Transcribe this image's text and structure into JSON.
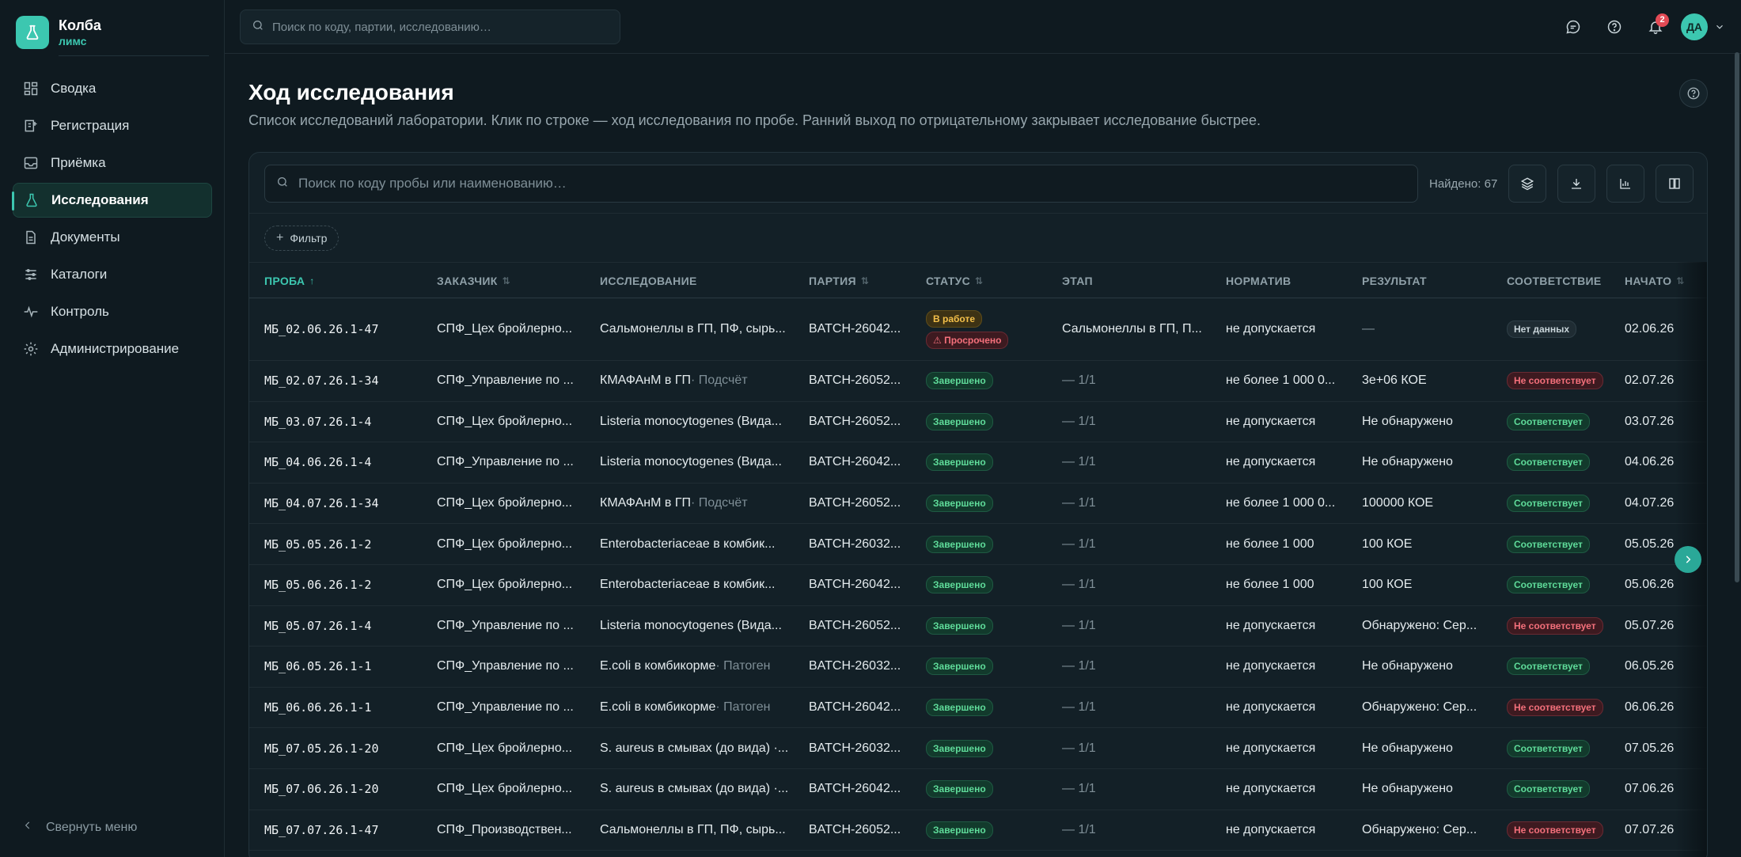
{
  "brand": {
    "name": "Колба",
    "sub": "лимс"
  },
  "sidebar": {
    "items": [
      {
        "label": "Сводка",
        "icon": "dashboard-icon"
      },
      {
        "label": "Регистрация",
        "icon": "register-icon"
      },
      {
        "label": "Приёмка",
        "icon": "inbox-icon"
      },
      {
        "label": "Исследования",
        "icon": "flask-icon",
        "active": true
      },
      {
        "label": "Документы",
        "icon": "document-icon"
      },
      {
        "label": "Каталоги",
        "icon": "catalog-icon"
      },
      {
        "label": "Контроль",
        "icon": "pulse-icon"
      },
      {
        "label": "Администрирование",
        "icon": "gear-icon"
      }
    ],
    "collapse_label": "Свернуть меню"
  },
  "topbar": {
    "search_placeholder": "Поиск по коду, партии, исследованию…",
    "notifications_count": "2",
    "avatar_initials": "ДА"
  },
  "page": {
    "title": "Ход исследования",
    "subtitle": "Список исследований лаборатории. Клик по строке — ход исследования по пробе. Ранний выход по отрицательному закрывает исследование быстрее."
  },
  "table_toolbar": {
    "search_placeholder": "Поиск по коду пробы или наименованию…",
    "found": "Найдено: 67",
    "filter_label": "Фильтр"
  },
  "columns": [
    "ПРОБА",
    "ЗАКАЗЧИК",
    "ИССЛЕДОВАНИЕ",
    "ПАРТИЯ",
    "СТАТУС",
    "ЭТАП",
    "НОРМАТИВ",
    "РЕЗУЛЬТАТ",
    "СООТВЕТСТВИЕ",
    "НАЧАТО"
  ],
  "rows": [
    {
      "sample": "МБ_02.06.26.1-47",
      "customer": "СПФ_Цех бройлерно...",
      "study": "Сальмонеллы в ГП, ПФ, сырь...",
      "study_note": "",
      "batch": "BATCH-26042...",
      "status": "В работе",
      "status2": "Просрочено",
      "stage": "Сальмонеллы в ГП, П...",
      "norm": "не допускается",
      "result": "—",
      "compliance": "Нет данных",
      "started": "02.06.26"
    },
    {
      "sample": "МБ_02.07.26.1-34",
      "customer": "СПФ_Управление по ...",
      "study": "КМАФАнМ в ГП",
      "study_note": " · Подсчёт",
      "batch": "BATCH-26052...",
      "status": "Завершено",
      "status2": "",
      "stage": "— 1/1",
      "norm": "не более 1 000 0...",
      "result": "3e+06 КОЕ",
      "compliance": "Не соответствует",
      "started": "02.07.26"
    },
    {
      "sample": "МБ_03.07.26.1-4",
      "customer": "СПФ_Цех бройлерно...",
      "study": "Listeria monocytogenes (Вида...",
      "study_note": "",
      "batch": "BATCH-26052...",
      "status": "Завершено",
      "status2": "",
      "stage": "— 1/1",
      "norm": "не допускается",
      "result": "Не обнаружено",
      "compliance": "Соответствует",
      "started": "03.07.26"
    },
    {
      "sample": "МБ_04.06.26.1-4",
      "customer": "СПФ_Управление по ...",
      "study": "Listeria monocytogenes (Вида...",
      "study_note": "",
      "batch": "BATCH-26042...",
      "status": "Завершено",
      "status2": "",
      "stage": "— 1/1",
      "norm": "не допускается",
      "result": "Не обнаружено",
      "compliance": "Соответствует",
      "started": "04.06.26"
    },
    {
      "sample": "МБ_04.07.26.1-34",
      "customer": "СПФ_Цех бройлерно...",
      "study": "КМАФАнМ в ГП",
      "study_note": " · Подсчёт",
      "batch": "BATCH-26052...",
      "status": "Завершено",
      "status2": "",
      "stage": "— 1/1",
      "norm": "не более 1 000 0...",
      "result": "100000 КОЕ",
      "compliance": "Соответствует",
      "started": "04.07.26"
    },
    {
      "sample": "МБ_05.05.26.1-2",
      "customer": "СПФ_Цех бройлерно...",
      "study": "Enterobacteriaceae в комбик...",
      "study_note": "",
      "batch": "BATCH-26032...",
      "status": "Завершено",
      "status2": "",
      "stage": "— 1/1",
      "norm": "не более 1 000",
      "result": "100 КОЕ",
      "compliance": "Соответствует",
      "started": "05.05.26"
    },
    {
      "sample": "МБ_05.06.26.1-2",
      "customer": "СПФ_Цех бройлерно...",
      "study": "Enterobacteriaceae в комбик...",
      "study_note": "",
      "batch": "BATCH-26042...",
      "status": "Завершено",
      "status2": "",
      "stage": "— 1/1",
      "norm": "не более 1 000",
      "result": "100 КОЕ",
      "compliance": "Соответствует",
      "started": "05.06.26"
    },
    {
      "sample": "МБ_05.07.26.1-4",
      "customer": "СПФ_Управление по ...",
      "study": "Listeria monocytogenes (Вида...",
      "study_note": "",
      "batch": "BATCH-26052...",
      "status": "Завершено",
      "status2": "",
      "stage": "— 1/1",
      "norm": "не допускается",
      "result": "Обнаружено: Сер...",
      "compliance": "Не соответствует",
      "started": "05.07.26"
    },
    {
      "sample": "МБ_06.05.26.1-1",
      "customer": "СПФ_Управление по ...",
      "study": "E.coli в комбикорме",
      "study_note": " · Патоген",
      "batch": "BATCH-26032...",
      "status": "Завершено",
      "status2": "",
      "stage": "— 1/1",
      "norm": "не допускается",
      "result": "Не обнаружено",
      "compliance": "Соответствует",
      "started": "06.05.26"
    },
    {
      "sample": "МБ_06.06.26.1-1",
      "customer": "СПФ_Управление по ...",
      "study": "E.coli в комбикорме",
      "study_note": " · Патоген",
      "batch": "BATCH-26042...",
      "status": "Завершено",
      "status2": "",
      "stage": "— 1/1",
      "norm": "не допускается",
      "result": "Обнаружено: Сер...",
      "compliance": "Не соответствует",
      "started": "06.06.26"
    },
    {
      "sample": "МБ_07.05.26.1-20",
      "customer": "СПФ_Цех бройлерно...",
      "study": "S. aureus в смывах (до вида) ·...",
      "study_note": "",
      "batch": "BATCH-26032...",
      "status": "Завершено",
      "status2": "",
      "stage": "— 1/1",
      "norm": "не допускается",
      "result": "Не обнаружено",
      "compliance": "Соответствует",
      "started": "07.05.26"
    },
    {
      "sample": "МБ_07.06.26.1-20",
      "customer": "СПФ_Цех бройлерно...",
      "study": "S. aureus в смывах (до вида) ·...",
      "study_note": "",
      "batch": "BATCH-26042...",
      "status": "Завершено",
      "status2": "",
      "stage": "— 1/1",
      "norm": "не допускается",
      "result": "Не обнаружено",
      "compliance": "Соответствует",
      "started": "07.06.26"
    },
    {
      "sample": "МБ_07.07.26.1-47",
      "customer": "СПФ_Производствен...",
      "study": "Сальмонеллы в ГП, ПФ, сырь...",
      "study_note": "",
      "batch": "BATCH-26052...",
      "status": "Завершено",
      "status2": "",
      "stage": "— 1/1",
      "norm": "не допускается",
      "result": "Обнаружено: Сер...",
      "compliance": "Не соответствует",
      "started": "07.07.26"
    }
  ],
  "colors": {
    "accent": "#3cc7b0",
    "ok": "#5fdc9a",
    "bad": "#f4707b",
    "warn": "#f4c04a"
  }
}
